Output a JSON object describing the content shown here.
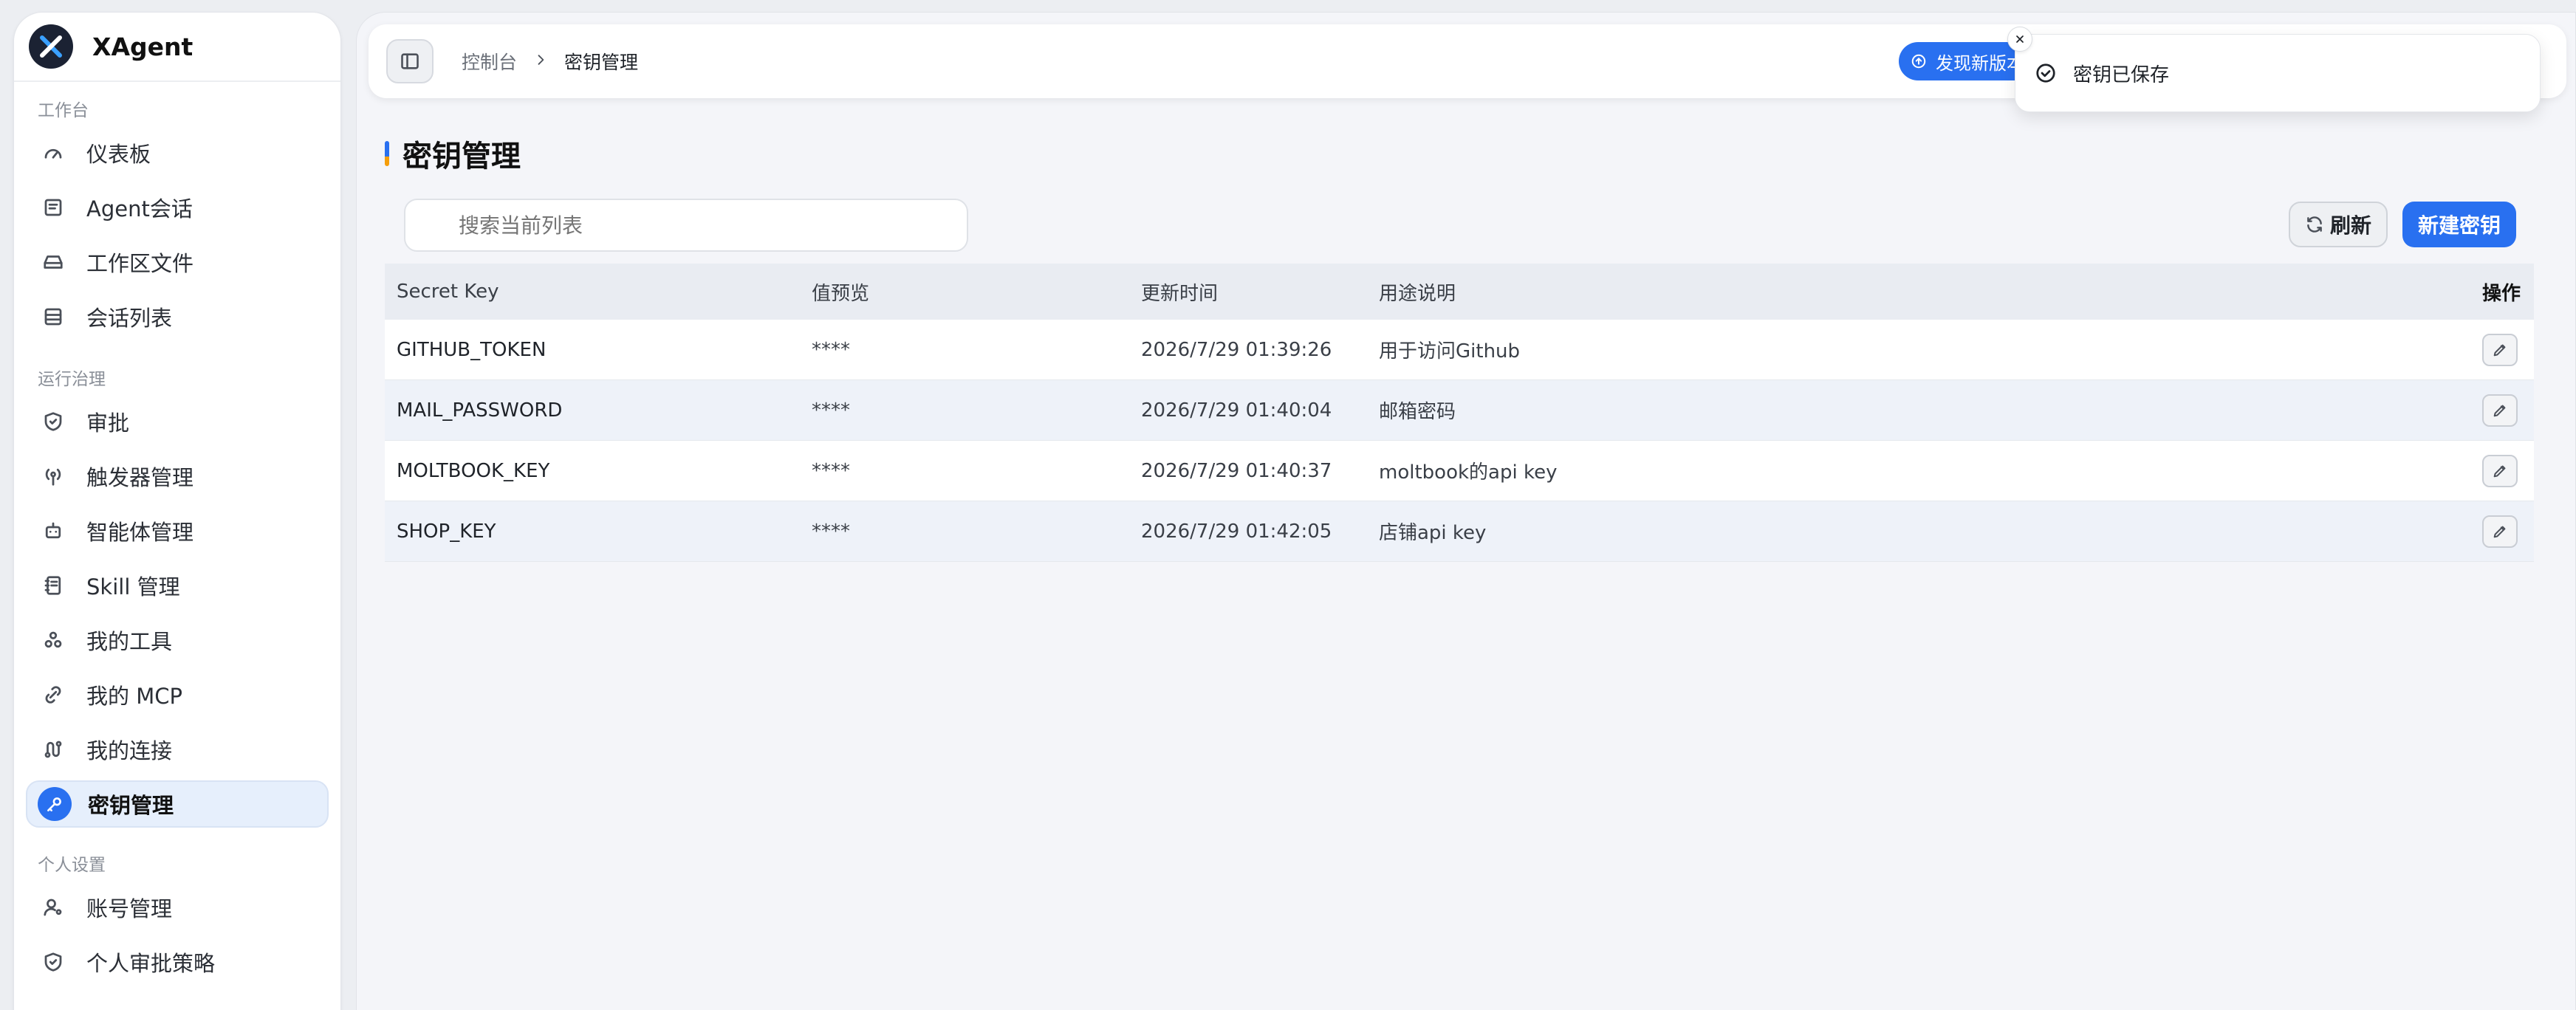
{
  "app": {
    "name": "XAgent"
  },
  "sidebar": {
    "sections": [
      {
        "title": "工作台",
        "items": [
          "仪表板",
          "Agent会话",
          "工作区文件",
          "会话列表"
        ]
      },
      {
        "title": "运行治理",
        "items": [
          "审批",
          "触发器管理",
          "智能体管理",
          "Skill 管理",
          "我的工具",
          "我的 MCP",
          "我的连接",
          "密钥管理"
        ]
      },
      {
        "title": "个人设置",
        "items": [
          "账号管理",
          "个人审批策略"
        ]
      }
    ],
    "active_item": "密钥管理"
  },
  "topbar": {
    "breadcrumb": [
      "控制台",
      "密钥管理"
    ],
    "update_label": "发现新版本"
  },
  "page": {
    "title": "密钥管理",
    "search_placeholder": "搜索当前列表",
    "refresh_label": "刷新",
    "new_label": "新建密钥"
  },
  "table": {
    "columns": [
      "Secret Key",
      "值预览",
      "更新时间",
      "用途说明",
      "操作"
    ],
    "rows": [
      {
        "key": "GITHUB_TOKEN",
        "preview": "****",
        "updated": "2026/7/29 01:39:26",
        "desc": "用于访问Github"
      },
      {
        "key": "MAIL_PASSWORD",
        "preview": "****",
        "updated": "2026/7/29 01:40:04",
        "desc": "邮箱密码"
      },
      {
        "key": "MOLTBOOK_KEY",
        "preview": "****",
        "updated": "2026/7/29 01:40:37",
        "desc": "moltbook的api key"
      },
      {
        "key": "SHOP_KEY",
        "preview": "****",
        "updated": "2026/7/29 01:42:05",
        "desc": "店铺api key"
      }
    ]
  },
  "toast": {
    "message": "密钥已保存"
  },
  "colors": {
    "accent": "#2970f0",
    "active_bg": "#e6effc",
    "title_mark_bottom": "#f59e0b"
  }
}
